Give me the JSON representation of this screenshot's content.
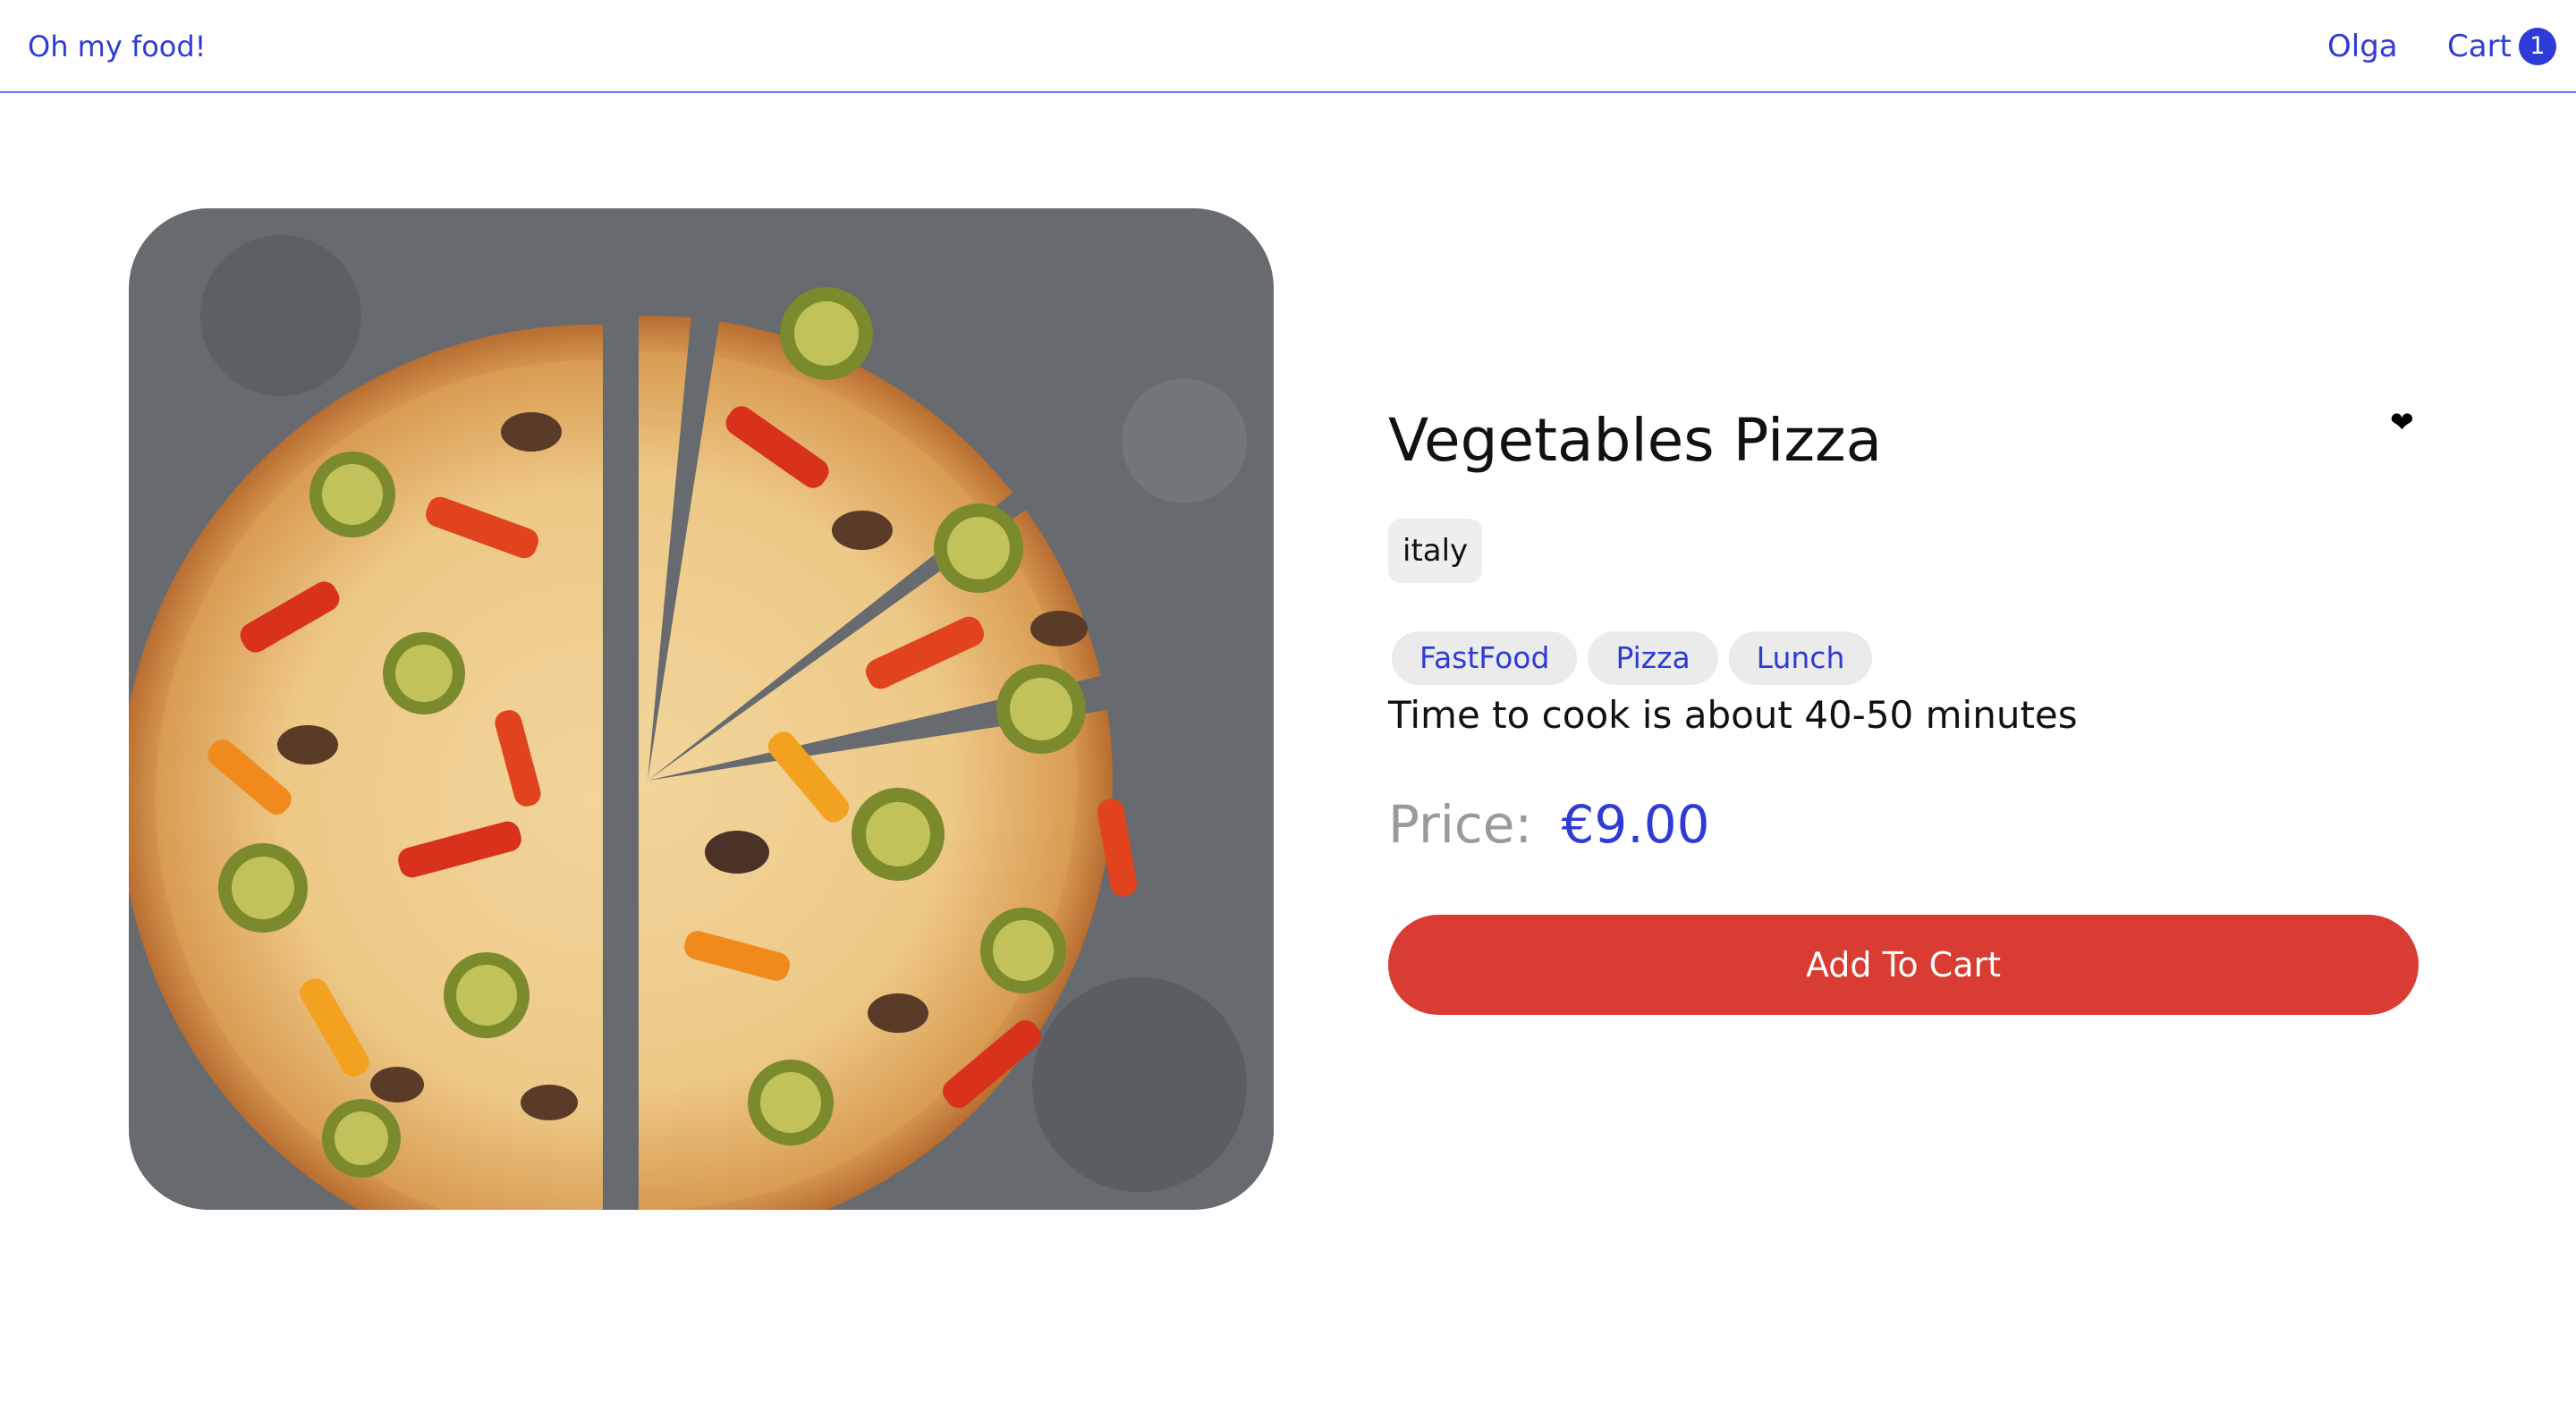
{
  "nav": {
    "brand": "Oh my food!",
    "user": "Olga",
    "cart_label": "Cart",
    "cart_count": "1"
  },
  "product": {
    "image_alt": "Vegetables pizza",
    "title": "Vegetables Pizza",
    "favorite_icon": "heart-icon",
    "origin": "italy",
    "tags": [
      "FastFood",
      "Pizza",
      "Lunch"
    ],
    "cook_time": "Time to cook is about 40-50 minutes",
    "price_label": "Price:",
    "price_value": "€9.00",
    "add_to_cart_label": "Add To Cart"
  },
  "colors": {
    "accent": "#2f3bd6",
    "button": "#d83c32",
    "tag_bg": "#ebebeb"
  }
}
